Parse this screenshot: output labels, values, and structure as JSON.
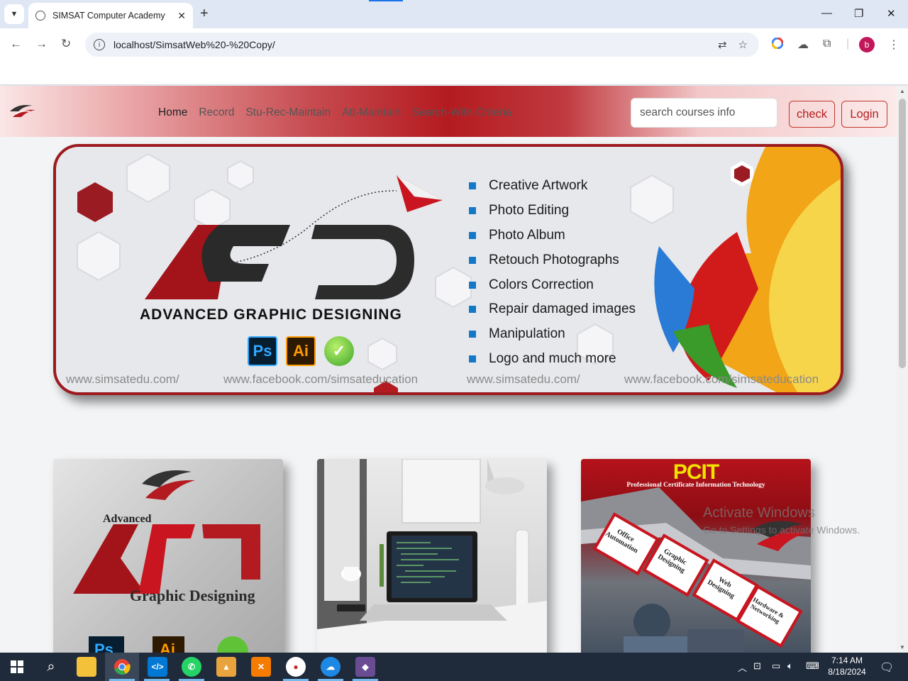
{
  "browser": {
    "tab_title": "SIMSAT Computer Academy",
    "url": "localhost/SimsatWeb%20-%20Copy/",
    "profile_initial": "b"
  },
  "navbar": {
    "links": [
      {
        "label": "Home",
        "active": true
      },
      {
        "label": "Record"
      },
      {
        "label": "Stu-Rec-Maintain"
      },
      {
        "label": "Att-Maintain"
      },
      {
        "label": "Search-With-Criteria"
      }
    ],
    "search_placeholder": "search courses info",
    "check_label": "check",
    "login_label": "Login"
  },
  "hero": {
    "title": "ADVANCED GRAPHIC DESIGNING",
    "logo_text": "AGD",
    "software": [
      "Ps",
      "Ai"
    ],
    "features": [
      "Creative Artwork",
      "Photo Editing",
      "Photo Album",
      "Retouch Photographs",
      "Colors Correction",
      "Repair damaged images",
      "Manipulation",
      "Logo and much more"
    ],
    "urls": [
      "www.simsatedu.com/",
      "www.facebook.com/simsateducation",
      "www.simsatedu.com/",
      "www.facebook.com/simsateducation"
    ]
  },
  "cards": {
    "card1": {
      "line1": "Advanced",
      "line2": "Graphic Designing",
      "software": [
        "Ps",
        "Ai"
      ]
    },
    "card3": {
      "title": "PCIT",
      "subtitle": "Professional Certificate Information Technology",
      "modules": [
        "Office Automation",
        "Graphic Designing",
        "Web Designing",
        "Hardware & Networking"
      ]
    }
  },
  "watermark": {
    "line1": "Activate Windows",
    "line2": "Go to Settings to activate Windows."
  },
  "taskbar": {
    "time": "7:14 AM",
    "date": "8/18/2024"
  },
  "colors": {
    "brand_red": "#b41b20",
    "feature_bullet": "#1478c8"
  }
}
